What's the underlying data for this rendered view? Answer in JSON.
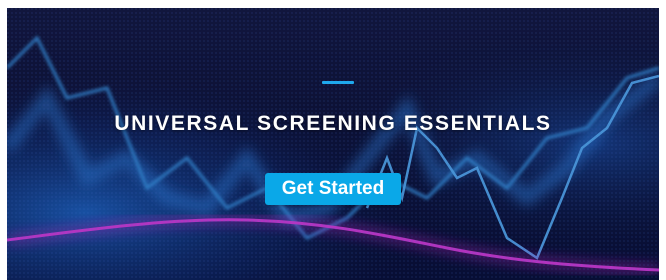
{
  "hero": {
    "title": "UNIVERSAL SCREENING ESSENTIALS",
    "cta_label": "Get Started",
    "background_image": "blurred-stock-ticker-chart-lines",
    "colors": {
      "accent_bar": "#1fa9ee",
      "button": "#0aa8e8",
      "background": "#0a0e2e",
      "magenta_line": "#d21fd8",
      "blue_line": "#3a9df0"
    }
  }
}
